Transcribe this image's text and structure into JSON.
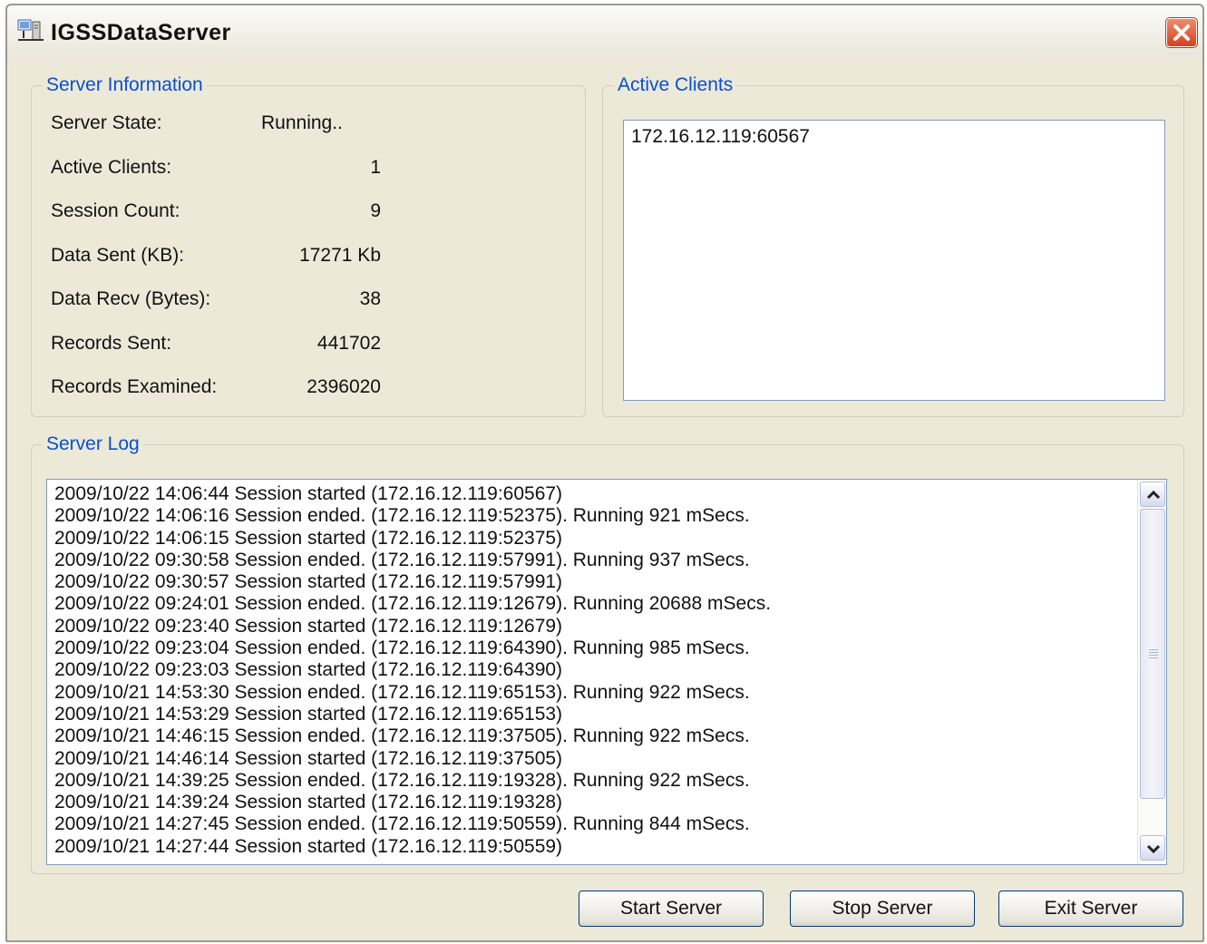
{
  "window": {
    "title": "IGSSDataServer"
  },
  "server_info": {
    "legend": "Server Information",
    "rows": [
      {
        "label": "Server State:",
        "value": "Running..",
        "align": "left"
      },
      {
        "label": "Active Clients:",
        "value": "1",
        "align": "right"
      },
      {
        "label": "Session Count:",
        "value": "9",
        "align": "right"
      },
      {
        "label": "Data Sent (KB):",
        "value": "17271 Kb",
        "align": "right"
      },
      {
        "label": "Data Recv (Bytes):",
        "value": "38",
        "align": "right"
      },
      {
        "label": "Records Sent:",
        "value": "441702",
        "align": "right"
      },
      {
        "label": "Records Examined:",
        "value": "2396020",
        "align": "right"
      }
    ]
  },
  "active_clients": {
    "legend": "Active Clients",
    "items": [
      "172.16.12.119:60567"
    ]
  },
  "server_log": {
    "legend": "Server Log",
    "lines": [
      "2009/10/22 14:06:44 Session started (172.16.12.119:60567)",
      "2009/10/22 14:06:16 Session ended.  (172.16.12.119:52375). Running 921 mSecs.",
      "2009/10/22 14:06:15 Session started (172.16.12.119:52375)",
      "2009/10/22 09:30:58 Session ended.  (172.16.12.119:57991). Running 937 mSecs.",
      "2009/10/22 09:30:57 Session started (172.16.12.119:57991)",
      "2009/10/22 09:24:01 Session ended.  (172.16.12.119:12679). Running 20688 mSecs.",
      "2009/10/22 09:23:40 Session started (172.16.12.119:12679)",
      "2009/10/22 09:23:04 Session ended.  (172.16.12.119:64390). Running 985 mSecs.",
      "2009/10/22 09:23:03 Session started (172.16.12.119:64390)",
      "2009/10/21 14:53:30 Session ended.  (172.16.12.119:65153). Running 922 mSecs.",
      "2009/10/21 14:53:29 Session started (172.16.12.119:65153)",
      "2009/10/21 14:46:15 Session ended.  (172.16.12.119:37505). Running 922 mSecs.",
      "2009/10/21 14:46:14 Session started (172.16.12.119:37505)",
      "2009/10/21 14:39:25 Session ended.  (172.16.12.119:19328). Running 922 mSecs.",
      "2009/10/21 14:39:24 Session started (172.16.12.119:19328)",
      "2009/10/21 14:27:45 Session ended.  (172.16.12.119:50559). Running 844 mSecs.",
      "2009/10/21 14:27:44 Session started (172.16.12.119:50559)"
    ]
  },
  "buttons": {
    "start": "Start Server",
    "stop": "Stop Server",
    "exit": "Exit Server"
  },
  "icons": {
    "app": "server-app-icon",
    "close": "close-icon",
    "scroll_up": "chevron-up-icon",
    "scroll_down": "chevron-down-icon"
  },
  "colors": {
    "legend_text": "#0a4fd0",
    "window_bg": "#ece9d8",
    "close_button": "#d6401f"
  }
}
